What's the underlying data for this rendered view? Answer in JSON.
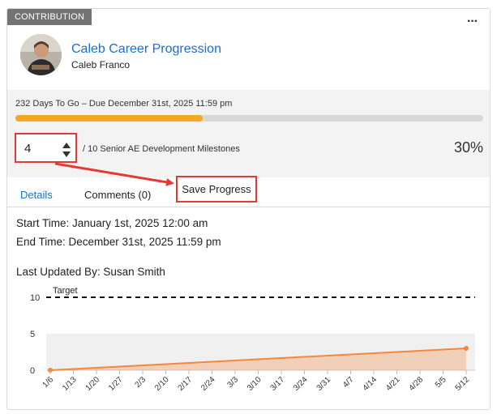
{
  "card": {
    "tag": "CONTRIBUTION",
    "more_icon": "ellipsis-icon",
    "title": "Caleb Career Progression",
    "owner": "Caleb Franco"
  },
  "progress": {
    "due_text": "232 Days To Go – Due December 31st, 2025 11:59 pm",
    "bar_fraction": 0.4,
    "current_value": "4",
    "of_text": "/ 10 Senior AE Development Milestones",
    "percent": "30%",
    "bar_color": "#f5a623"
  },
  "tabs": {
    "details": "Details",
    "comments": "Comments (0)"
  },
  "save_button": "Save Progress",
  "info": {
    "start": "Start Time: January 1st, 2025 12:00 am",
    "end": "End Time: December 31st, 2025 11:59 pm",
    "updated_by": "Last Updated By: Susan Smith"
  },
  "chart_data": {
    "type": "area",
    "x": [
      "1/6",
      "1/13",
      "1/20",
      "1/27",
      "2/3",
      "2/10",
      "2/17",
      "2/24",
      "3/3",
      "3/10",
      "3/17",
      "3/24",
      "3/31",
      "4/7",
      "4/14",
      "4/21",
      "4/28",
      "5/5",
      "5/12"
    ],
    "series": [
      {
        "points": [
          [
            "1/6",
            0
          ],
          [
            "5/12",
            3
          ]
        ],
        "color": "#f5883a"
      }
    ],
    "target": {
      "label": "Target",
      "value": 10
    },
    "yticks": [
      0,
      5,
      10
    ],
    "ylim": [
      0,
      10
    ]
  }
}
